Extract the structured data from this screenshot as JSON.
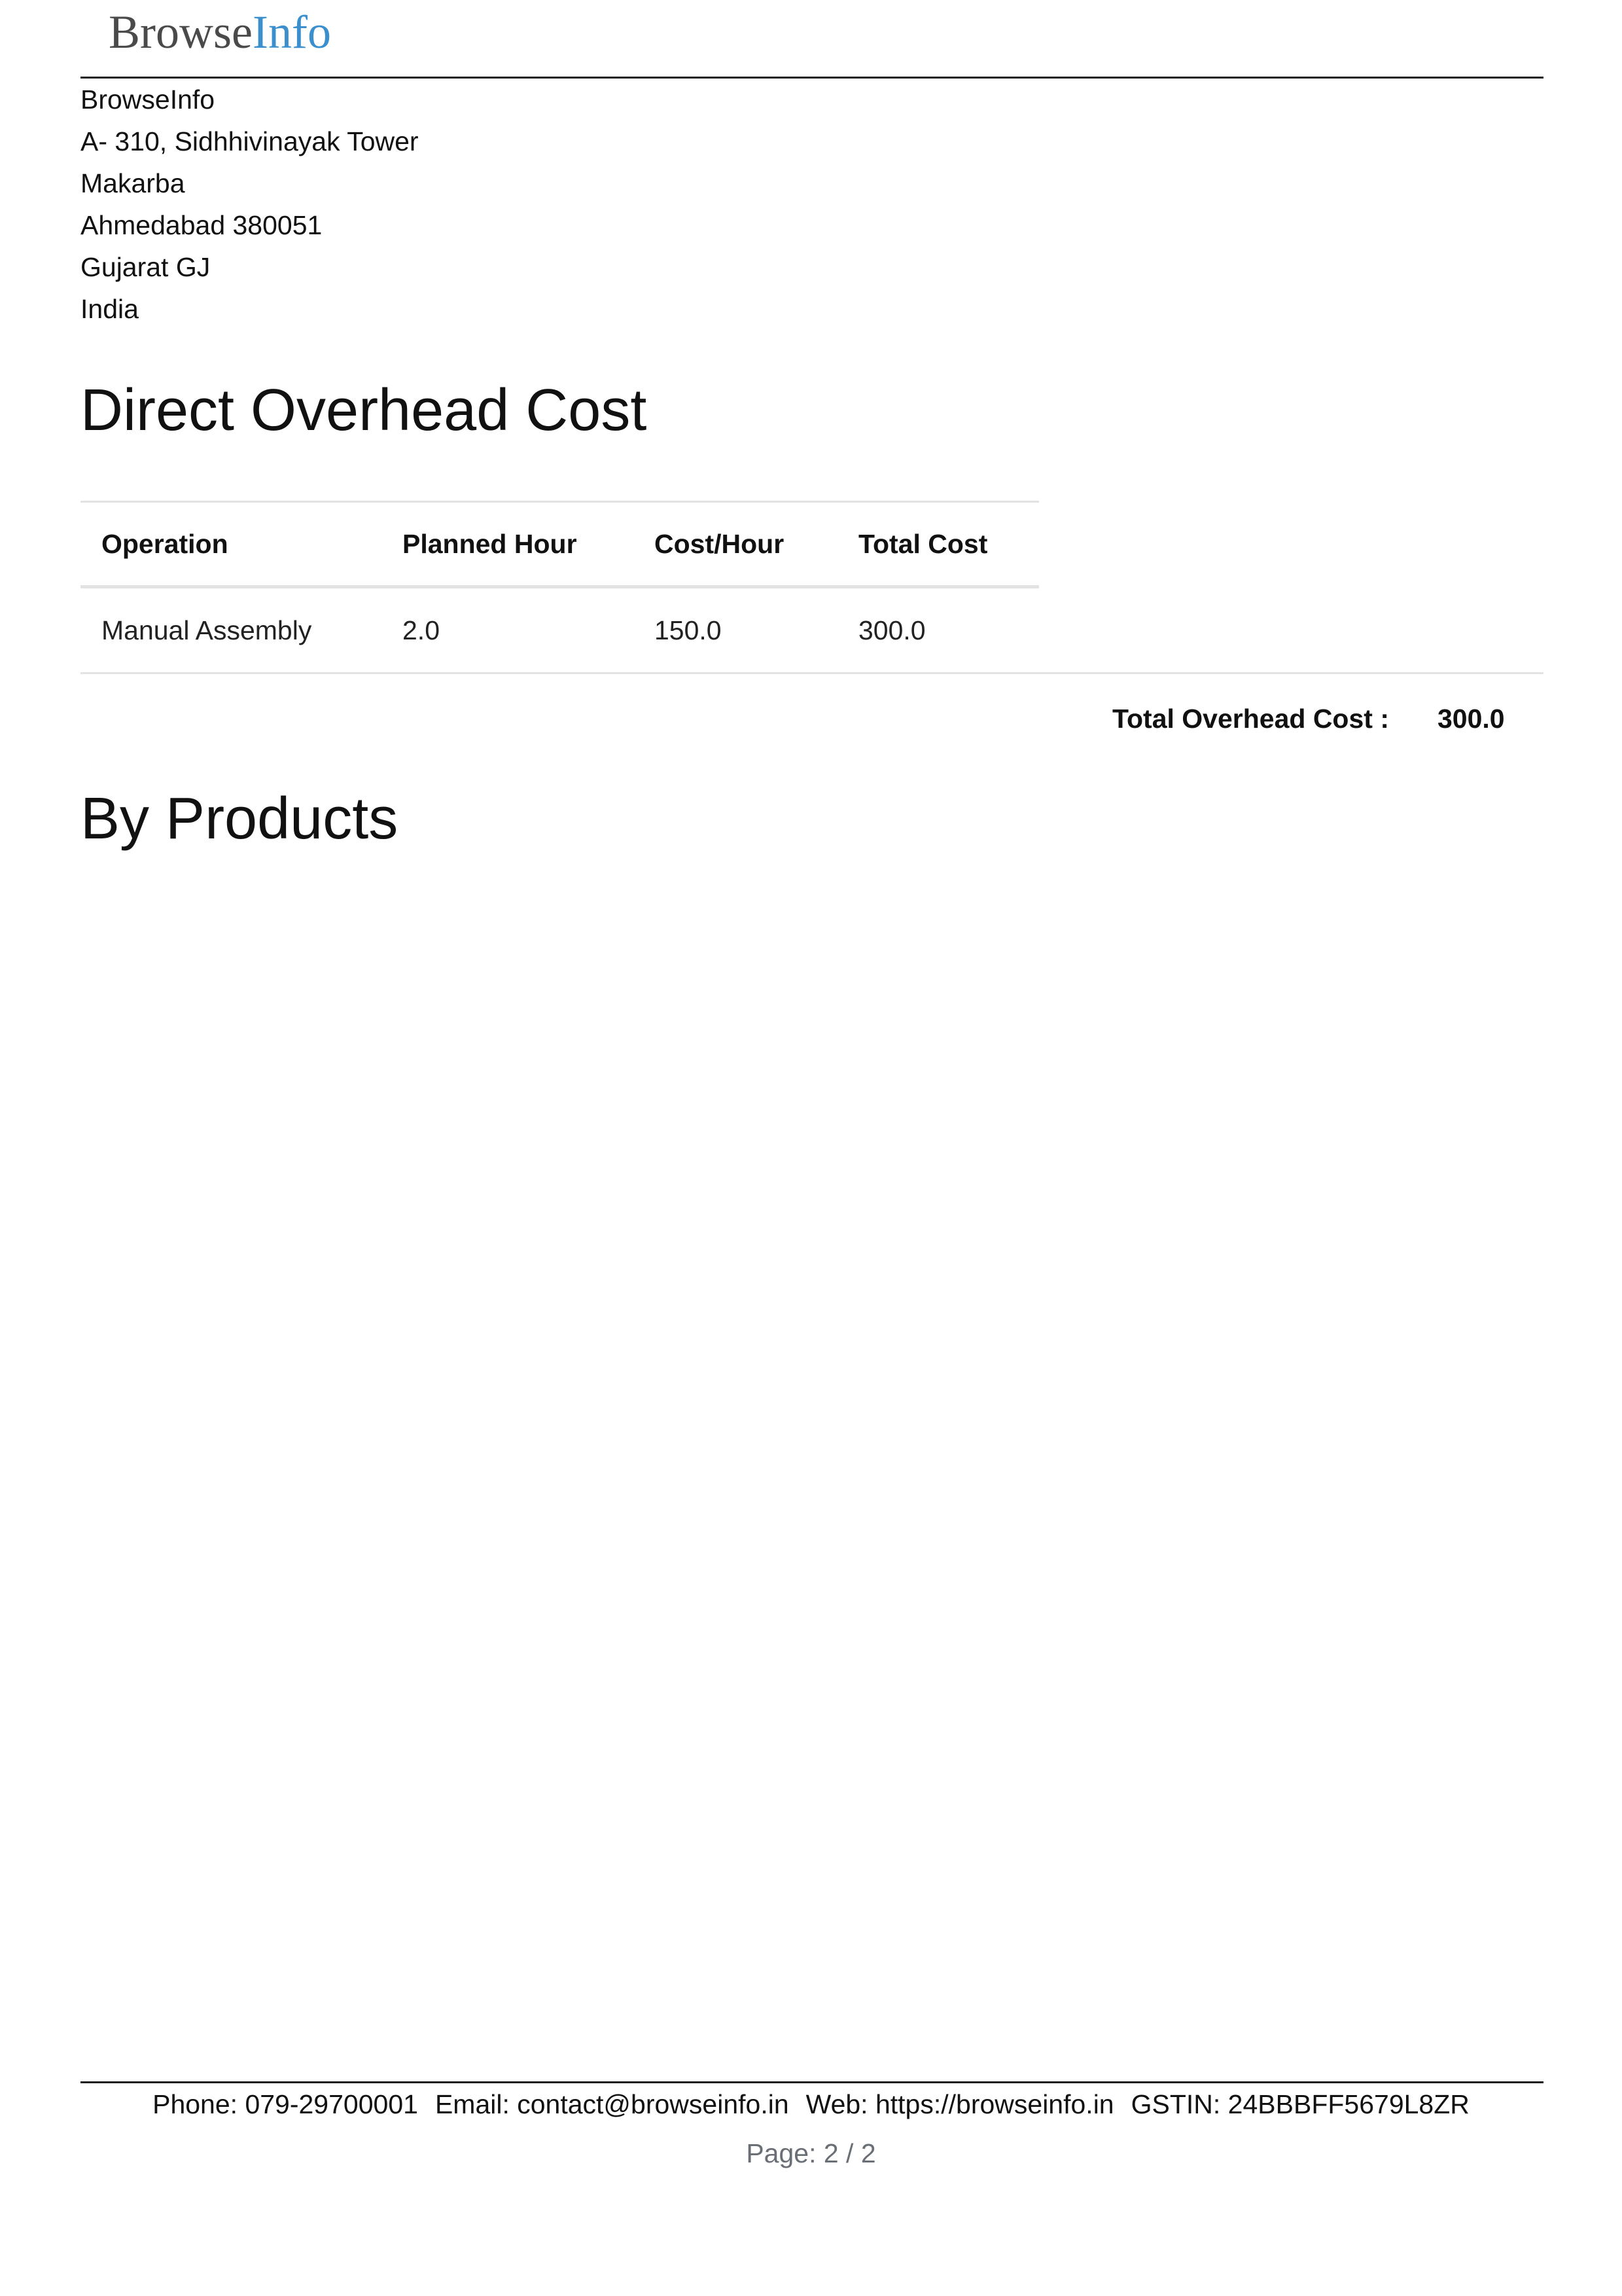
{
  "header": {
    "logo_browse": "Browse",
    "logo_info": "Info"
  },
  "company": {
    "name": "BrowseInfo",
    "street": "A- 310, Sidhhivinayak Tower",
    "area": "Makarba",
    "city_zip": "Ahmedabad 380051",
    "state": "Gujarat GJ",
    "country": "India"
  },
  "overhead": {
    "title": "Direct Overhead Cost",
    "columns": [
      "Operation",
      "Planned Hour",
      "Cost/Hour",
      "Total Cost"
    ],
    "rows": [
      {
        "operation": "Manual Assembly",
        "planned_hour": "2.0",
        "cost_per_hour": "150.0",
        "total_cost": "300.0"
      }
    ],
    "total_label": "Total Overhead Cost :",
    "total_value": "300.0"
  },
  "by_products": {
    "title": "By Products"
  },
  "footer": {
    "phone": "Phone: 079-29700001",
    "email": "Email: contact@browseinfo.in",
    "web": "Web: https://browseinfo.in",
    "gstin": "GSTIN: 24BBBFF5679L8ZR",
    "page": "Page: 2 / 2"
  },
  "colors": {
    "logo_browse": "#4a4a4a",
    "logo_info": "#3a8fcc",
    "page_number": "#6a6f75",
    "table_rule": "#e3e3e3"
  }
}
